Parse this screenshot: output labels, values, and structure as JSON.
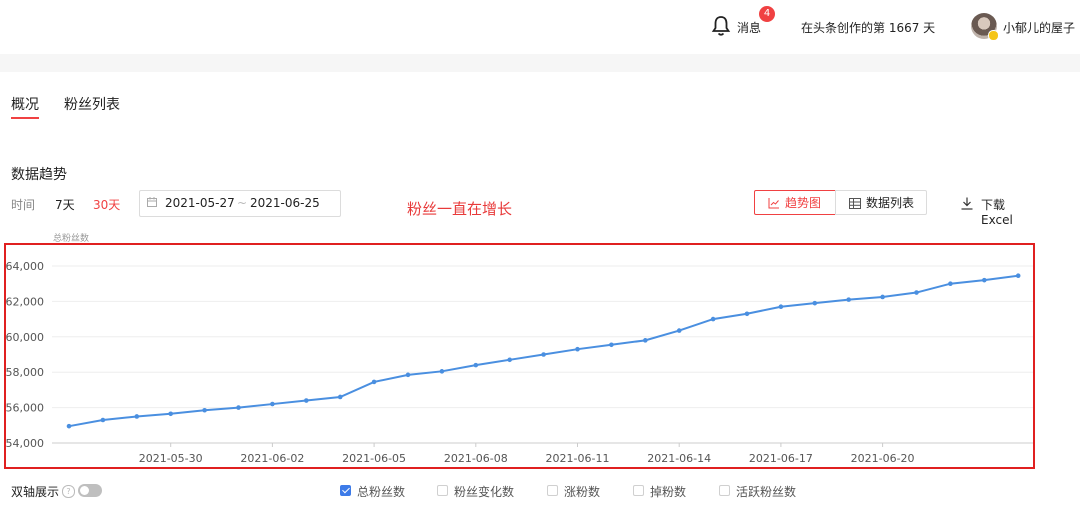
{
  "header": {
    "messages_label": "消息",
    "messages_badge": "4",
    "creation_days": "在头条创作的第 1667 天",
    "username": "小郁儿的屋子"
  },
  "tabs": [
    {
      "label": "概况",
      "active": true
    },
    {
      "label": "粉丝列表",
      "active": false
    }
  ],
  "trend": {
    "title": "数据趋势",
    "time_label": "时间",
    "ranges": [
      {
        "label": "7天",
        "active": false
      },
      {
        "label": "30天",
        "active": true
      }
    ],
    "date_start": "2021-05-27",
    "date_sep": "~",
    "date_end": "2021-06-25",
    "annotation": "粉丝一直在增长",
    "view_trend": "趋势图",
    "view_list": "数据列表",
    "download": "下载Excel"
  },
  "chart_data": {
    "type": "line",
    "ylabel": "总粉丝数",
    "ylim": [
      54000,
      64000
    ],
    "yticks": [
      54000,
      56000,
      58000,
      60000,
      62000,
      64000
    ],
    "xtick_labels": [
      "2021-05-30",
      "2021-06-02",
      "2021-06-05",
      "2021-06-08",
      "2021-06-11",
      "2021-06-14",
      "2021-06-17",
      "2021-06-20"
    ],
    "x": [
      "2021-05-27",
      "2021-05-28",
      "2021-05-29",
      "2021-05-30",
      "2021-05-31",
      "2021-06-01",
      "2021-06-02",
      "2021-06-03",
      "2021-06-04",
      "2021-06-05",
      "2021-06-06",
      "2021-06-07",
      "2021-06-08",
      "2021-06-09",
      "2021-06-10",
      "2021-06-11",
      "2021-06-12",
      "2021-06-13",
      "2021-06-14",
      "2021-06-15",
      "2021-06-16",
      "2021-06-17",
      "2021-06-18",
      "2021-06-19",
      "2021-06-20",
      "2021-06-21",
      "2021-06-22",
      "2021-06-23",
      "2021-06-24"
    ],
    "series": [
      {
        "name": "总粉丝数",
        "color": "#4a8fe0",
        "values": [
          54950,
          55300,
          55500,
          55650,
          55850,
          56000,
          56200,
          56400,
          56600,
          57450,
          57850,
          58050,
          58400,
          58700,
          59000,
          59300,
          59550,
          59800,
          60350,
          61000,
          61300,
          61700,
          61900,
          62100,
          62250,
          62500,
          63000,
          63200,
          63450
        ]
      }
    ],
    "grid": true
  },
  "footer": {
    "dual_axis_label": "双轴展示",
    "metrics": [
      {
        "label": "总粉丝数",
        "checked": true
      },
      {
        "label": "粉丝变化数",
        "checked": false
      },
      {
        "label": "涨粉数",
        "checked": false
      },
      {
        "label": "掉粉数",
        "checked": false
      },
      {
        "label": "活跃粉丝数",
        "checked": false
      }
    ]
  }
}
